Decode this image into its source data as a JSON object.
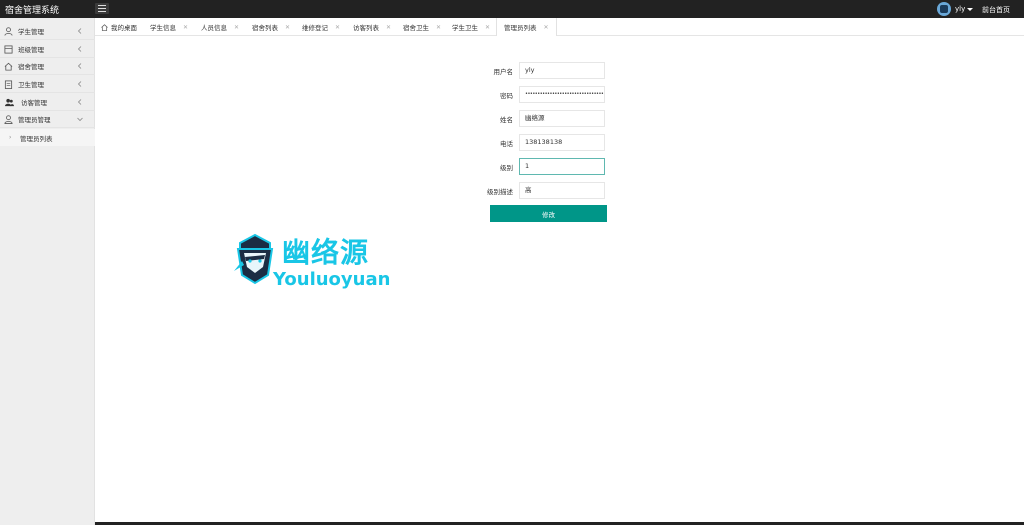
{
  "app": {
    "title": "宿舍管理系统",
    "username": "yly",
    "front_link": "前台首页"
  },
  "sidebar": {
    "items": [
      {
        "label": "学生管理",
        "icon": "user-icon"
      },
      {
        "label": "班级管理",
        "icon": "class-icon"
      },
      {
        "label": "宿舍管理",
        "icon": "home-icon"
      },
      {
        "label": "卫生管理",
        "icon": "clipboard-icon"
      },
      {
        "label": "访客管理",
        "icon": "users-icon"
      },
      {
        "label": "管理员管理",
        "icon": "admin-icon"
      }
    ],
    "sub_items": [
      {
        "label": "管理员列表"
      }
    ]
  },
  "tabs": [
    {
      "label": "我的桌面",
      "home": true
    },
    {
      "label": "学生信息"
    },
    {
      "label": "人员信息"
    },
    {
      "label": "宿舍列表"
    },
    {
      "label": "维修登记"
    },
    {
      "label": "访客列表"
    },
    {
      "label": "宿舍卫生"
    },
    {
      "label": "学生卫生"
    },
    {
      "label": "管理员列表",
      "active": true
    }
  ],
  "form": {
    "fields": [
      {
        "label": "用户名",
        "value": "yly"
      },
      {
        "label": "密码",
        "value": "••••••••••••••••••••••••••••••••"
      },
      {
        "label": "姓名",
        "value": "幽络源"
      },
      {
        "label": "电话",
        "value": "138138138"
      },
      {
        "label": "级别",
        "value": "1"
      },
      {
        "label": "级别描述",
        "value": "高"
      }
    ],
    "submit_label": "修改"
  },
  "watermark": {
    "cn": "幽络源",
    "en": "Youluoyuan"
  },
  "colors": {
    "topbar": "#222222",
    "accent": "#009688",
    "watermark": "#19c6e6"
  }
}
